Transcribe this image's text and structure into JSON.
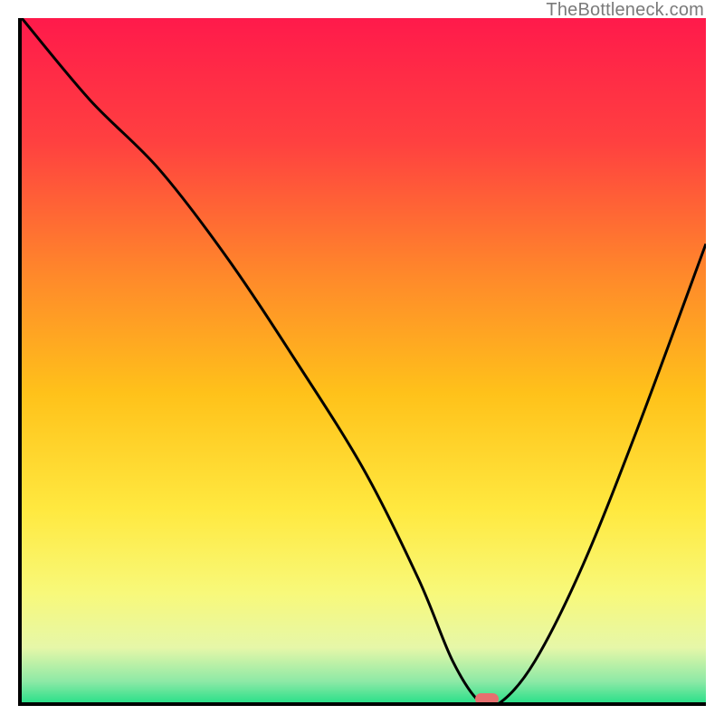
{
  "watermark": "TheBottleneck.com",
  "chart_data": {
    "type": "line",
    "title": "",
    "xlabel": "",
    "ylabel": "",
    "xlim": [
      0,
      100
    ],
    "ylim": [
      0,
      100
    ],
    "grid": false,
    "background_gradient": {
      "stops": [
        {
          "offset": 0,
          "color": "#ff1a4b"
        },
        {
          "offset": 18,
          "color": "#ff4040"
        },
        {
          "offset": 38,
          "color": "#ff8a2a"
        },
        {
          "offset": 55,
          "color": "#ffc21a"
        },
        {
          "offset": 72,
          "color": "#ffe940"
        },
        {
          "offset": 84,
          "color": "#f8f97a"
        },
        {
          "offset": 92,
          "color": "#e6f7a8"
        },
        {
          "offset": 97,
          "color": "#8ce9a6"
        },
        {
          "offset": 100,
          "color": "#2de08a"
        }
      ]
    },
    "series": [
      {
        "name": "bottleneck-curve",
        "color": "#000000",
        "x": [
          0,
          10,
          20,
          30,
          40,
          50,
          58,
          63,
          67,
          70,
          75,
          82,
          90,
          100
        ],
        "y": [
          100,
          88,
          78,
          65,
          50,
          34,
          18,
          6,
          0,
          0,
          6,
          20,
          40,
          67
        ]
      }
    ],
    "marker": {
      "x": 68,
      "y": 0,
      "color": "#e76f6f"
    }
  }
}
